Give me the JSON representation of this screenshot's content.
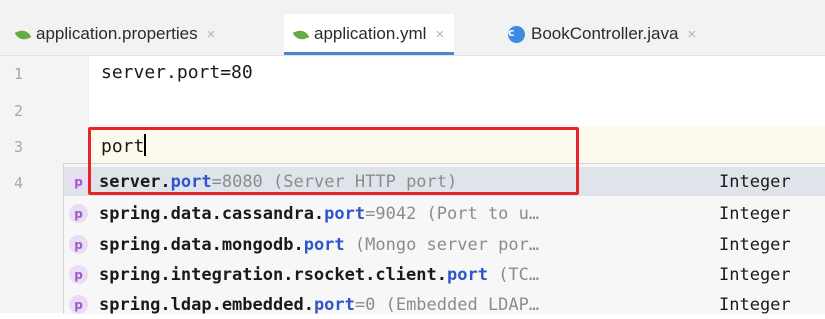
{
  "tabs": [
    {
      "label": "application.properties",
      "icon": "spring-leaf-icon",
      "active": false
    },
    {
      "label": "application.yml",
      "icon": "spring-leaf-icon",
      "active": true
    },
    {
      "label": "BookController.java",
      "icon": "class-icon",
      "active": false
    }
  ],
  "close_glyph": "×",
  "class_icon_letter": "c",
  "editor": {
    "line_numbers": [
      "1",
      "2",
      "3",
      "4"
    ],
    "lines": [
      "server.port=80",
      "",
      "port",
      ""
    ]
  },
  "completion": {
    "property_icon_letter": "p",
    "items": [
      {
        "prefix": "server.",
        "match": "port",
        "rest": "=8080 (Server HTTP port)",
        "type": "Integer"
      },
      {
        "prefix": "spring.data.cassandra.",
        "match": "port",
        "rest": "=9042 (Port to u…",
        "type": "Integer"
      },
      {
        "prefix": "spring.data.mongodb.",
        "match": "port",
        "rest": " (Mongo server por…",
        "type": "Integer"
      },
      {
        "prefix": "spring.integration.rsocket.client.",
        "match": "port",
        "rest": " (TC…",
        "type": "Integer"
      },
      {
        "prefix": "spring.ldap.embedded.",
        "match": "port",
        "rest": "=0 (Embedded LDAP…",
        "type": "Integer"
      }
    ]
  },
  "colors": {
    "highlight_box": "#e8242b",
    "match_text": "#2f55cc",
    "accent_underline": "#4a88c7"
  }
}
